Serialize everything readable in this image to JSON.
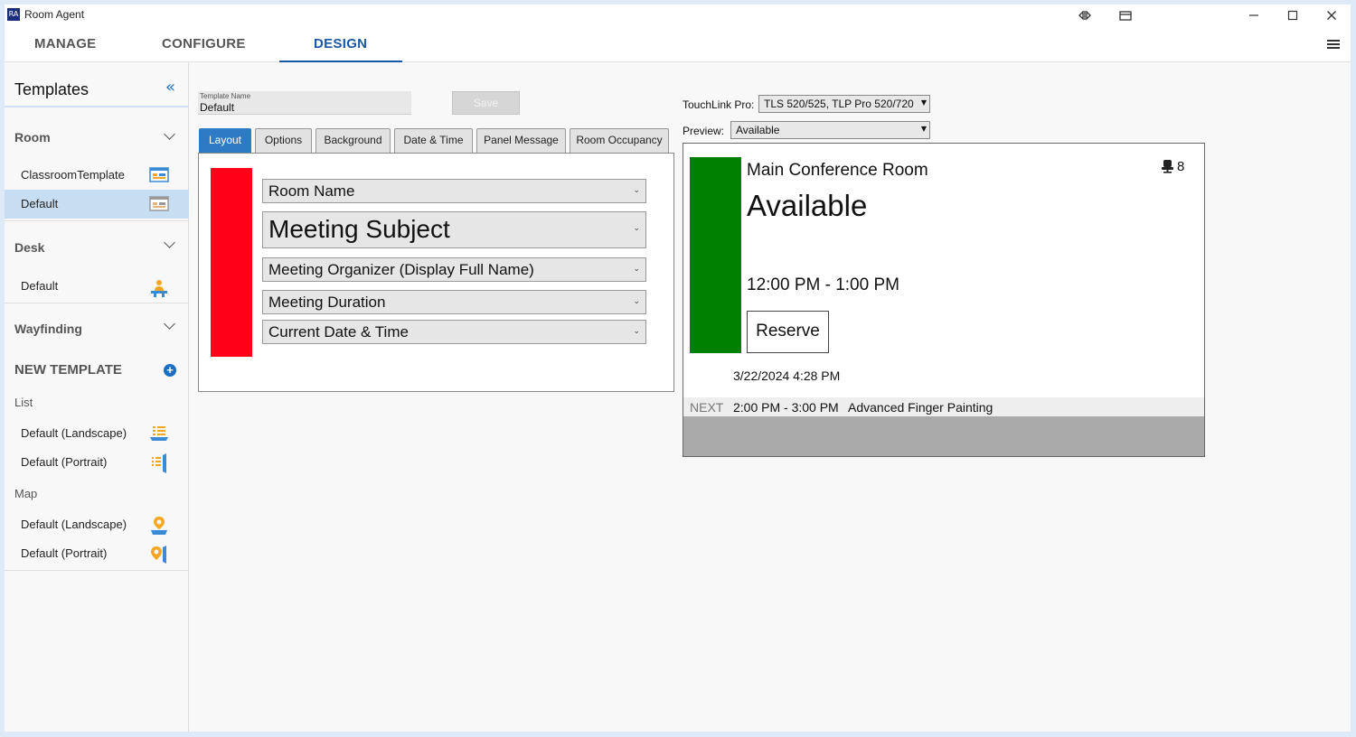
{
  "window": {
    "app_icon": "RA",
    "title": "Room Agent",
    "controls": [
      "swap-view-icon",
      "restore-window-icon",
      "minimize-icon",
      "maximize-icon",
      "close-icon"
    ]
  },
  "nav": {
    "tabs": [
      {
        "label": "MANAGE",
        "active": false
      },
      {
        "label": "CONFIGURE",
        "active": false
      },
      {
        "label": "DESIGN",
        "active": true
      }
    ],
    "accent": "#1a58a6"
  },
  "sidebar": {
    "title": "Templates",
    "room": {
      "label": "Room",
      "items": [
        {
          "label": "ClassroomTemplate",
          "selected": false,
          "icon": "room-layout-icon"
        },
        {
          "label": "Default",
          "selected": true,
          "icon": "room-layout-icon"
        }
      ]
    },
    "desk": {
      "label": "Desk",
      "items": [
        {
          "label": "Default",
          "icon": "desk-person-icon"
        }
      ]
    },
    "wayfinding": {
      "label": "Wayfinding"
    },
    "new_template": {
      "label": "NEW TEMPLATE",
      "list": {
        "label": "List",
        "items": [
          {
            "label": "Default (Landscape)",
            "icon": "list-landscape-icon"
          },
          {
            "label": "Default (Portrait)",
            "icon": "list-portrait-icon"
          }
        ]
      },
      "map": {
        "label": "Map",
        "items": [
          {
            "label": "Default (Landscape)",
            "icon": "map-landscape-icon"
          },
          {
            "label": "Default (Portrait)",
            "icon": "map-portrait-icon"
          }
        ]
      }
    }
  },
  "editor": {
    "template_name_caption": "Template Name",
    "template_name": "Default",
    "save_label": "Save",
    "tabs": [
      "Layout",
      "Options",
      "Background",
      "Date & Time",
      "Panel Message",
      "Room Occupancy"
    ],
    "active_tab": "Layout",
    "status_color": "#ff0018",
    "fields": [
      "Room Name",
      "Meeting Subject",
      "Meeting Organizer (Display Full Name)",
      "Meeting Duration",
      "Current Date & Time"
    ]
  },
  "preview": {
    "touchlink_label": "TouchLink Pro:",
    "touchlink_value": "TLS 520/525, TLP Pro 520/720",
    "preview_label": "Preview:",
    "preview_value": "Available",
    "status_color": "#008000",
    "room_name": "Main Conference Room",
    "occupancy": "8",
    "status": "Available",
    "time_range": "12:00 PM - 1:00 PM",
    "reserve_label": "Reserve",
    "current_datetime": "3/22/2024 4:28 PM",
    "next_label": "NEXT",
    "next_time": "2:00 PM - 3:00 PM",
    "next_subject": "Advanced Finger Painting"
  }
}
